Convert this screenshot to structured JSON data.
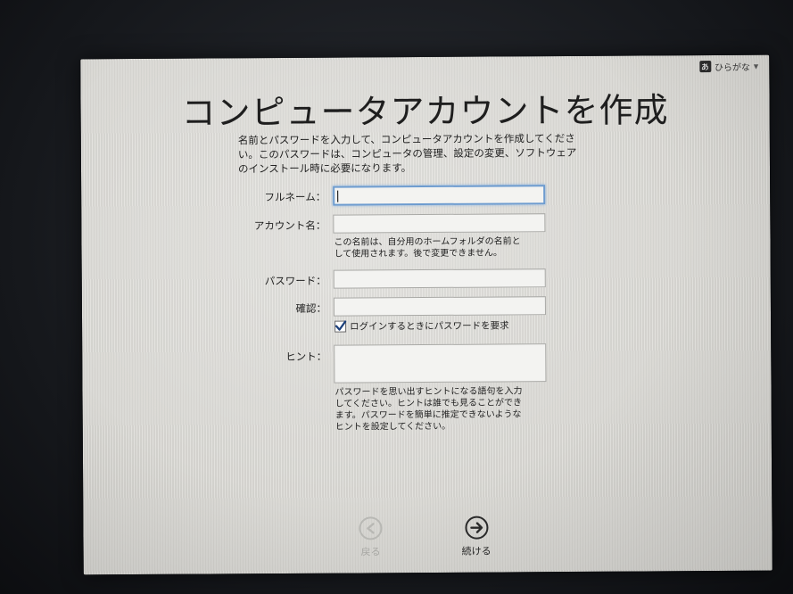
{
  "input_menu": {
    "glyph": "あ",
    "label": "ひらがな",
    "chevron": "▼"
  },
  "title": "コンピュータアカウントを作成",
  "intro_lines": [
    "名前とパスワードを入力して、コンピュータアカウントを作成してくださ",
    "い。このパスワードは、コンピュータの管理、設定の変更、ソフトウェア",
    "のインストール時に必要になります。"
  ],
  "form": {
    "full_name": {
      "label": "フルネーム：",
      "value": ""
    },
    "account_name": {
      "label": "アカウント名：",
      "value": "",
      "help_lines": [
        "この名前は、自分用のホームフォルダの名前と",
        "して使用されます。後で変更できません。"
      ]
    },
    "password": {
      "label": "パスワード：",
      "value": ""
    },
    "verify": {
      "label": "確認：",
      "value": ""
    },
    "require_password": {
      "label": "ログインするときにパスワードを要求",
      "checked": true
    },
    "hint": {
      "label": "ヒント：",
      "value": "",
      "help_lines": [
        "パスワードを思い出すヒントになる語句を入力",
        "してください。ヒントは誰でも見ることができ",
        "ます。パスワードを簡単に推定できないような",
        "ヒントを設定してください。"
      ]
    }
  },
  "nav": {
    "back_label": "戻る",
    "continue_label": "続ける"
  },
  "colors": {
    "focus_ring": "#6e9ccf",
    "panel": "#dcdbd6"
  }
}
